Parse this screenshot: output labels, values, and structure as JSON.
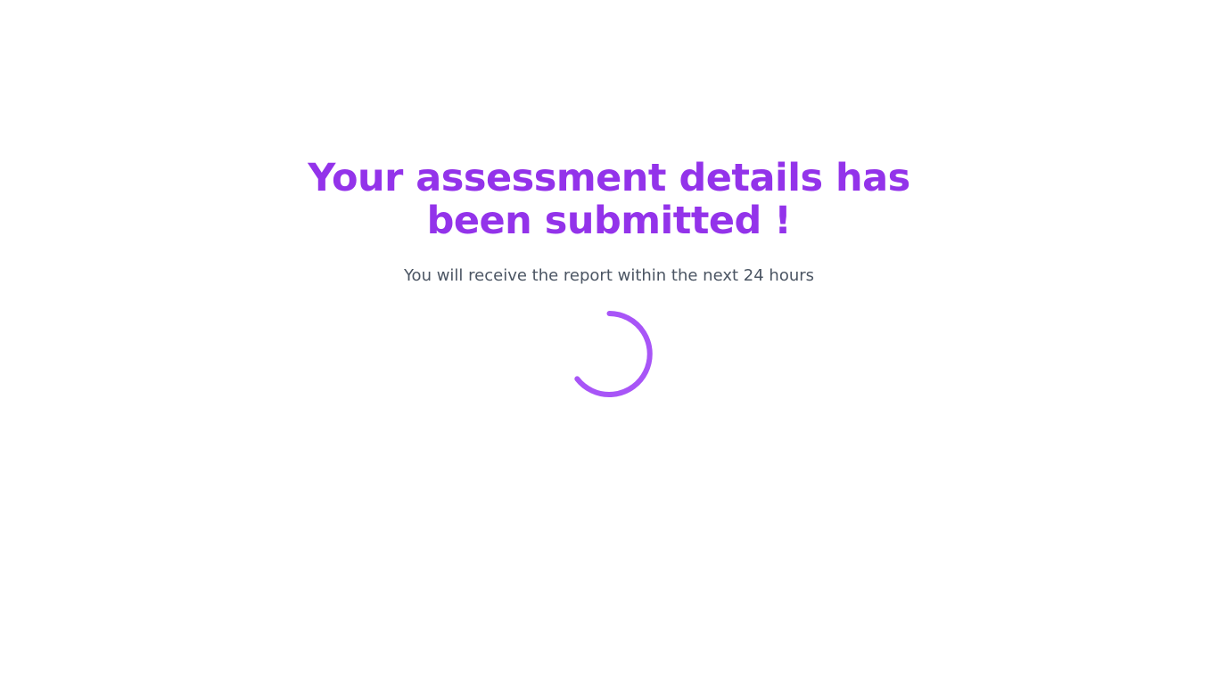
{
  "confirmation": {
    "title": "Your assessment details has been submitted !",
    "subtitle": "You will receive the report within the next 24 hours"
  },
  "spinner": {
    "icon": "loading-spinner-icon",
    "color": "#a855f7"
  },
  "colors": {
    "title": "#9333ea",
    "subtitle": "#4b5563",
    "background": "#ffffff"
  }
}
